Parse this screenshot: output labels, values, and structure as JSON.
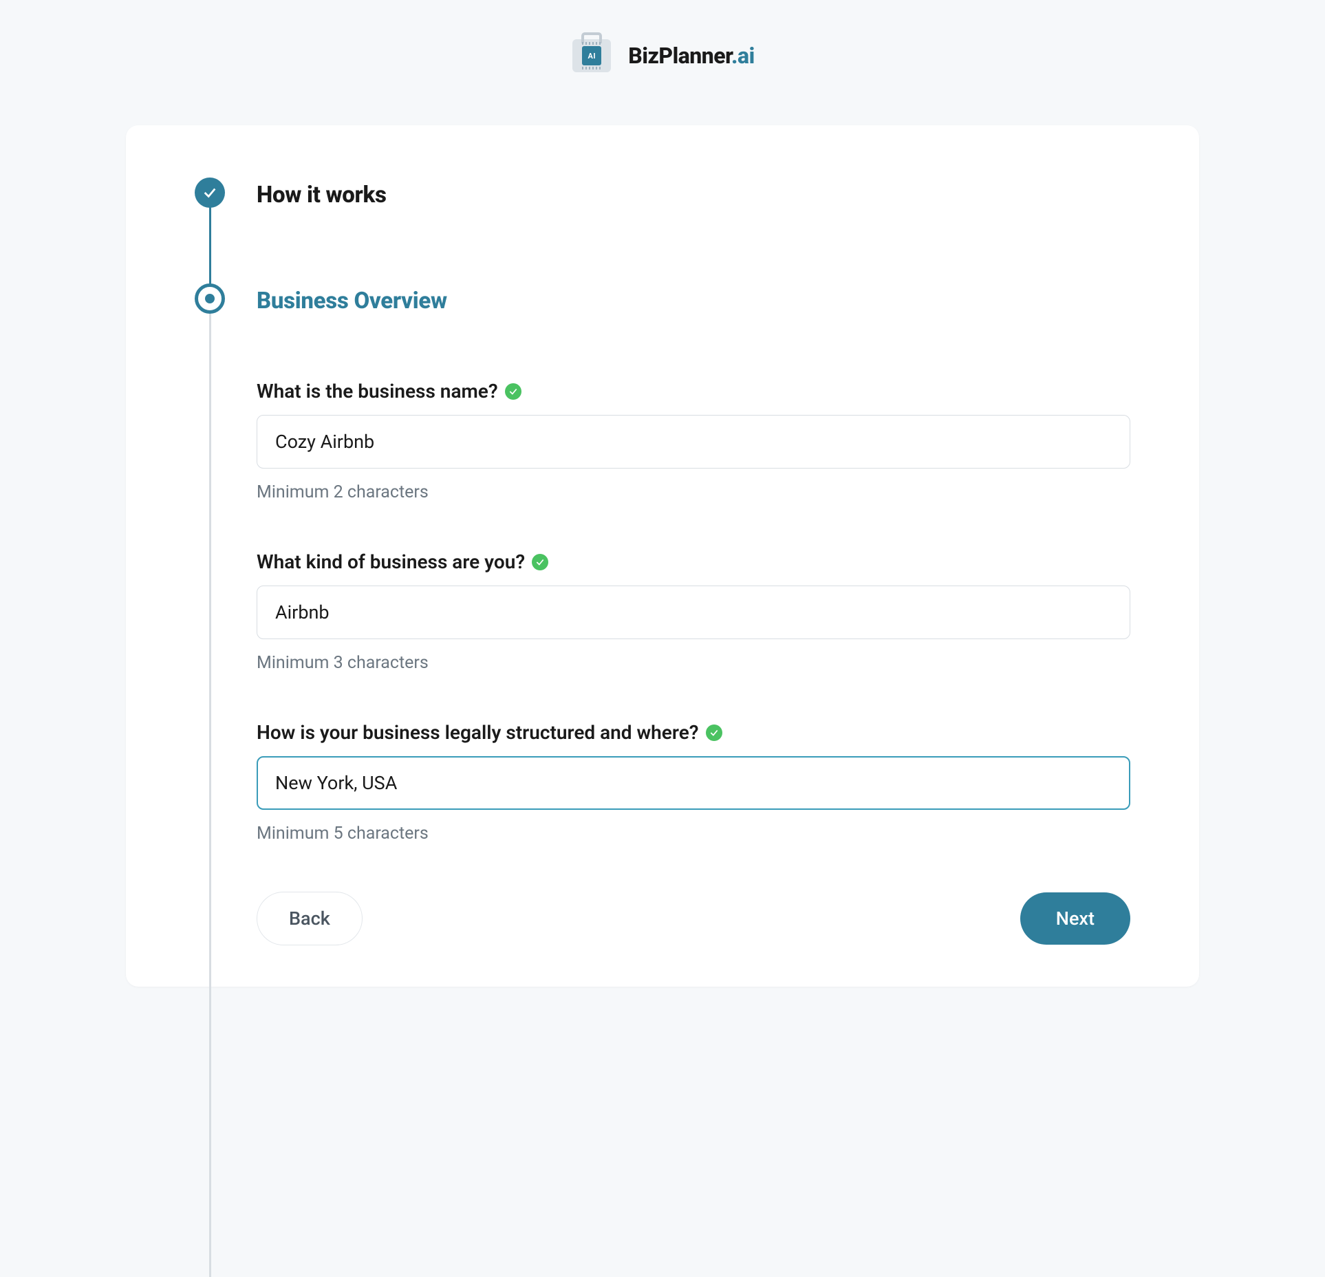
{
  "brand": {
    "name_part1": "BizPlanner",
    "name_part2": ".ai",
    "chip_label": "AI"
  },
  "steps": {
    "how_it_works": {
      "title": "How it works"
    },
    "business_overview": {
      "title": "Business Overview"
    }
  },
  "form": {
    "fields": {
      "business_name": {
        "label": "What is the business name?",
        "value": "Cozy Airbnb",
        "hint": "Minimum 2 characters"
      },
      "business_kind": {
        "label": "What kind of business are you?",
        "value": "Airbnb",
        "hint": "Minimum 3 characters"
      },
      "legal_structure": {
        "label": "How is your business legally structured and where?",
        "value": "New York, USA",
        "hint": "Minimum 5 characters"
      }
    }
  },
  "actions": {
    "back": "Back",
    "next": "Next"
  }
}
